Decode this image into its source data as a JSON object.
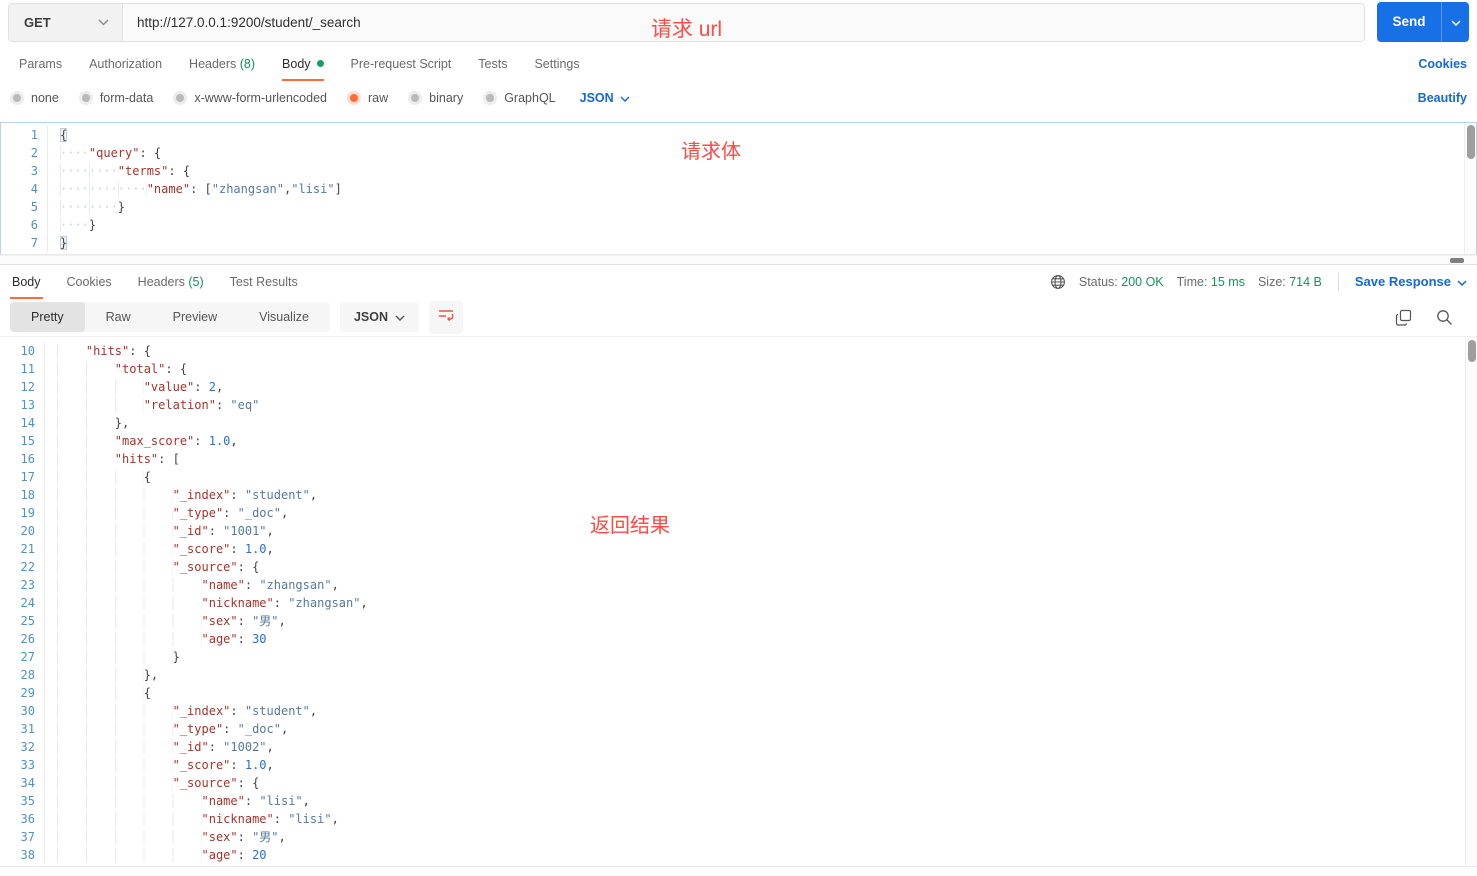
{
  "colors": {
    "accent_orange": "#ff6c37",
    "link_blue": "#1567dc",
    "status_green": "#15935a",
    "annotation_red": "#ff4b45",
    "send_blue": "#1770e6"
  },
  "request": {
    "method": "GET",
    "url": "http://127.0.0.1:9200/student/_search",
    "send_label": "Send",
    "annotation_url": "请求 url",
    "annotation_body": "请求体",
    "cookies_link": "Cookies",
    "beautify_link": "Beautify",
    "body_format": "JSON",
    "tabs": [
      {
        "id": "params",
        "label": "Params"
      },
      {
        "id": "authorization",
        "label": "Authorization"
      },
      {
        "id": "headers",
        "label": "Headers",
        "count": "(8)"
      },
      {
        "id": "body",
        "label": "Body",
        "dot": true,
        "active": true
      },
      {
        "id": "pre-request-script",
        "label": "Pre-request Script"
      },
      {
        "id": "tests",
        "label": "Tests"
      },
      {
        "id": "settings",
        "label": "Settings"
      }
    ],
    "body_modes": [
      {
        "id": "none",
        "label": "none"
      },
      {
        "id": "form-data",
        "label": "form-data"
      },
      {
        "id": "x-www-form-urlencoded",
        "label": "x-www-form-urlencoded"
      },
      {
        "id": "raw",
        "label": "raw",
        "selected": true
      },
      {
        "id": "binary",
        "label": "binary"
      },
      {
        "id": "graphql",
        "label": "GraphQL"
      }
    ],
    "editor_lines": [
      {
        "n": 1,
        "t": [
          [
            "brace",
            "{"
          ]
        ]
      },
      {
        "n": 2,
        "t": [
          [
            "ws",
            "    "
          ],
          [
            "key",
            "\"query\""
          ],
          [
            "punct",
            ": {"
          ]
        ]
      },
      {
        "n": 3,
        "t": [
          [
            "ws",
            "        "
          ],
          [
            "key",
            "\"terms\""
          ],
          [
            "punct",
            ": {"
          ]
        ]
      },
      {
        "n": 4,
        "t": [
          [
            "ws",
            "            "
          ],
          [
            "key",
            "\"name\""
          ],
          [
            "punct",
            ": ["
          ],
          [
            "str",
            "\"zhangsan\""
          ],
          [
            "punct",
            ","
          ],
          [
            "str",
            "\"lisi\""
          ],
          [
            "punct",
            "]"
          ]
        ]
      },
      {
        "n": 5,
        "t": [
          [
            "ws",
            "        "
          ],
          [
            "punct",
            "}"
          ]
        ]
      },
      {
        "n": 6,
        "t": [
          [
            "ws",
            "    "
          ],
          [
            "punct",
            "}"
          ]
        ]
      },
      {
        "n": 7,
        "t": [
          [
            "brace",
            "}"
          ]
        ]
      }
    ]
  },
  "response": {
    "annotation_result": "返回结果",
    "save_label": "Save Response",
    "format": "JSON",
    "tabs": [
      {
        "id": "body",
        "label": "Body",
        "active": true
      },
      {
        "id": "cookies",
        "label": "Cookies"
      },
      {
        "id": "headers",
        "label": "Headers",
        "count": "(5)"
      },
      {
        "id": "test-results",
        "label": "Test Results"
      }
    ],
    "meta": [
      {
        "id": "status",
        "label": "Status:",
        "value": "200 OK"
      },
      {
        "id": "time",
        "label": "Time:",
        "value": "15 ms"
      },
      {
        "id": "size",
        "label": "Size:",
        "value": "714 B"
      }
    ],
    "view_tabs": [
      {
        "id": "pretty",
        "label": "Pretty",
        "active": true
      },
      {
        "id": "raw",
        "label": "Raw"
      },
      {
        "id": "preview",
        "label": "Preview"
      },
      {
        "id": "visualize",
        "label": "Visualize"
      }
    ],
    "editor_lines": [
      {
        "n": 10,
        "t": [
          [
            "ws",
            "    "
          ],
          [
            "key",
            "\"hits\""
          ],
          [
            "punct",
            ": {"
          ]
        ]
      },
      {
        "n": 11,
        "t": [
          [
            "ws",
            "        "
          ],
          [
            "key",
            "\"total\""
          ],
          [
            "punct",
            ": {"
          ]
        ]
      },
      {
        "n": 12,
        "t": [
          [
            "ws",
            "            "
          ],
          [
            "key",
            "\"value\""
          ],
          [
            "punct",
            ": "
          ],
          [
            "num",
            "2"
          ],
          [
            "punct",
            ","
          ]
        ]
      },
      {
        "n": 13,
        "t": [
          [
            "ws",
            "            "
          ],
          [
            "key",
            "\"relation\""
          ],
          [
            "punct",
            ": "
          ],
          [
            "str",
            "\"eq\""
          ]
        ]
      },
      {
        "n": 14,
        "t": [
          [
            "ws",
            "        "
          ],
          [
            "punct",
            "},"
          ]
        ]
      },
      {
        "n": 15,
        "t": [
          [
            "ws",
            "        "
          ],
          [
            "key",
            "\"max_score\""
          ],
          [
            "punct",
            ": "
          ],
          [
            "num",
            "1.0"
          ],
          [
            "punct",
            ","
          ]
        ]
      },
      {
        "n": 16,
        "t": [
          [
            "ws",
            "        "
          ],
          [
            "key",
            "\"hits\""
          ],
          [
            "punct",
            ": ["
          ]
        ]
      },
      {
        "n": 17,
        "t": [
          [
            "ws",
            "            "
          ],
          [
            "punct",
            "{"
          ]
        ]
      },
      {
        "n": 18,
        "t": [
          [
            "ws",
            "                "
          ],
          [
            "key",
            "\"_index\""
          ],
          [
            "punct",
            ": "
          ],
          [
            "str",
            "\"student\""
          ],
          [
            "punct",
            ","
          ]
        ]
      },
      {
        "n": 19,
        "t": [
          [
            "ws",
            "                "
          ],
          [
            "key",
            "\"_type\""
          ],
          [
            "punct",
            ": "
          ],
          [
            "str",
            "\"_doc\""
          ],
          [
            "punct",
            ","
          ]
        ]
      },
      {
        "n": 20,
        "t": [
          [
            "ws",
            "                "
          ],
          [
            "key",
            "\"_id\""
          ],
          [
            "punct",
            ": "
          ],
          [
            "str",
            "\"1001\""
          ],
          [
            "punct",
            ","
          ]
        ]
      },
      {
        "n": 21,
        "t": [
          [
            "ws",
            "                "
          ],
          [
            "key",
            "\"_score\""
          ],
          [
            "punct",
            ": "
          ],
          [
            "num",
            "1.0"
          ],
          [
            "punct",
            ","
          ]
        ]
      },
      {
        "n": 22,
        "t": [
          [
            "ws",
            "                "
          ],
          [
            "key",
            "\"_source\""
          ],
          [
            "punct",
            ": {"
          ]
        ]
      },
      {
        "n": 23,
        "t": [
          [
            "ws",
            "                    "
          ],
          [
            "key",
            "\"name\""
          ],
          [
            "punct",
            ": "
          ],
          [
            "str",
            "\"zhangsan\""
          ],
          [
            "punct",
            ","
          ]
        ]
      },
      {
        "n": 24,
        "t": [
          [
            "ws",
            "                    "
          ],
          [
            "key",
            "\"nickname\""
          ],
          [
            "punct",
            ": "
          ],
          [
            "str",
            "\"zhangsan\""
          ],
          [
            "punct",
            ","
          ]
        ]
      },
      {
        "n": 25,
        "t": [
          [
            "ws",
            "                    "
          ],
          [
            "key",
            "\"sex\""
          ],
          [
            "punct",
            ": "
          ],
          [
            "str",
            "\"男\""
          ],
          [
            "punct",
            ","
          ]
        ]
      },
      {
        "n": 26,
        "t": [
          [
            "ws",
            "                    "
          ],
          [
            "key",
            "\"age\""
          ],
          [
            "punct",
            ": "
          ],
          [
            "num",
            "30"
          ]
        ]
      },
      {
        "n": 27,
        "t": [
          [
            "ws",
            "                "
          ],
          [
            "punct",
            "}"
          ]
        ]
      },
      {
        "n": 28,
        "t": [
          [
            "ws",
            "            "
          ],
          [
            "punct",
            "},"
          ]
        ]
      },
      {
        "n": 29,
        "t": [
          [
            "ws",
            "            "
          ],
          [
            "punct",
            "{"
          ]
        ]
      },
      {
        "n": 30,
        "t": [
          [
            "ws",
            "                "
          ],
          [
            "key",
            "\"_index\""
          ],
          [
            "punct",
            ": "
          ],
          [
            "str",
            "\"student\""
          ],
          [
            "punct",
            ","
          ]
        ]
      },
      {
        "n": 31,
        "t": [
          [
            "ws",
            "                "
          ],
          [
            "key",
            "\"_type\""
          ],
          [
            "punct",
            ": "
          ],
          [
            "str",
            "\"_doc\""
          ],
          [
            "punct",
            ","
          ]
        ]
      },
      {
        "n": 32,
        "t": [
          [
            "ws",
            "                "
          ],
          [
            "key",
            "\"_id\""
          ],
          [
            "punct",
            ": "
          ],
          [
            "str",
            "\"1002\""
          ],
          [
            "punct",
            ","
          ]
        ]
      },
      {
        "n": 33,
        "t": [
          [
            "ws",
            "                "
          ],
          [
            "key",
            "\"_score\""
          ],
          [
            "punct",
            ": "
          ],
          [
            "num",
            "1.0"
          ],
          [
            "punct",
            ","
          ]
        ]
      },
      {
        "n": 34,
        "t": [
          [
            "ws",
            "                "
          ],
          [
            "key",
            "\"_source\""
          ],
          [
            "punct",
            ": {"
          ]
        ]
      },
      {
        "n": 35,
        "t": [
          [
            "ws",
            "                    "
          ],
          [
            "key",
            "\"name\""
          ],
          [
            "punct",
            ": "
          ],
          [
            "str",
            "\"lisi\""
          ],
          [
            "punct",
            ","
          ]
        ]
      },
      {
        "n": 36,
        "t": [
          [
            "ws",
            "                    "
          ],
          [
            "key",
            "\"nickname\""
          ],
          [
            "punct",
            ": "
          ],
          [
            "str",
            "\"lisi\""
          ],
          [
            "punct",
            ","
          ]
        ]
      },
      {
        "n": 37,
        "t": [
          [
            "ws",
            "                    "
          ],
          [
            "key",
            "\"sex\""
          ],
          [
            "punct",
            ": "
          ],
          [
            "str",
            "\"男\""
          ],
          [
            "punct",
            ","
          ]
        ]
      },
      {
        "n": 38,
        "t": [
          [
            "ws",
            "                    "
          ],
          [
            "key",
            "\"age\""
          ],
          [
            "punct",
            ": "
          ],
          [
            "num",
            "20"
          ]
        ]
      }
    ]
  }
}
